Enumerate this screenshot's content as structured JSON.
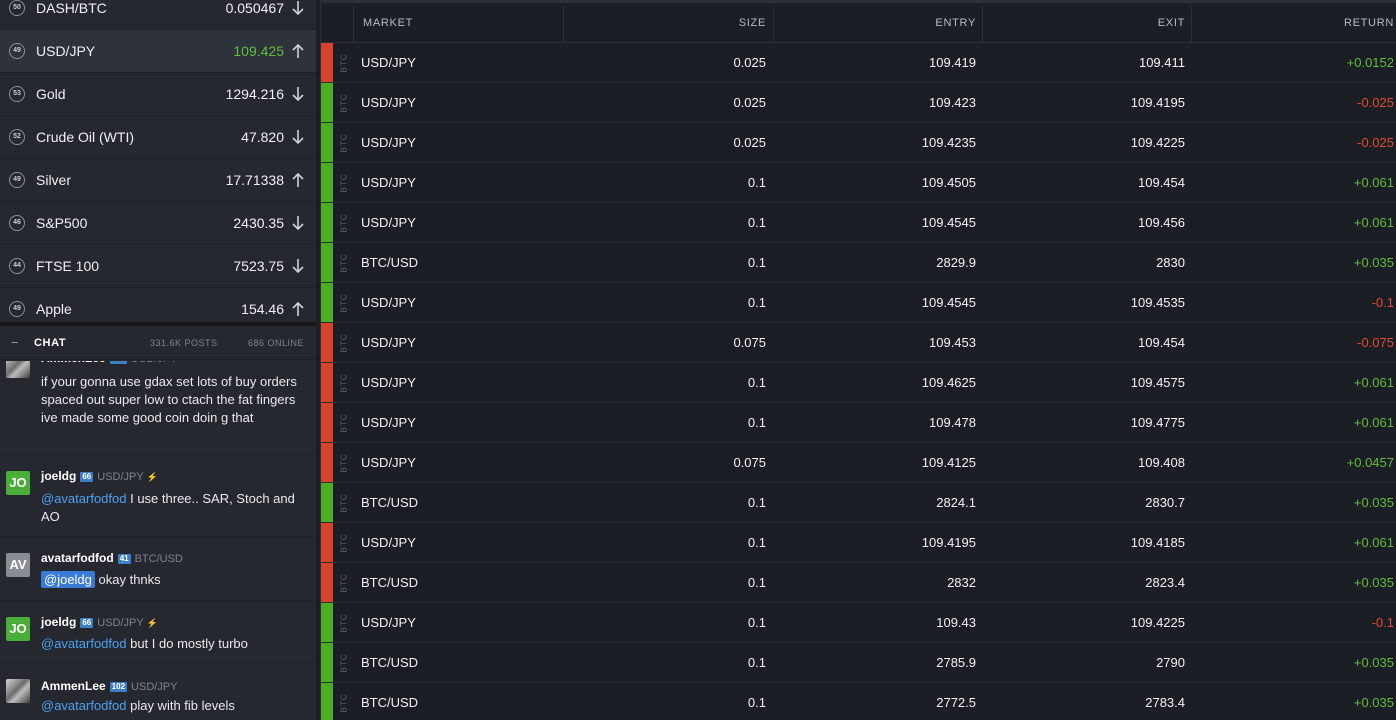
{
  "markets": [
    {
      "badge": "50",
      "name": "DASH/BTC",
      "price": "0.050467",
      "dir": "down",
      "selected": false
    },
    {
      "badge": "49",
      "name": "USD/JPY",
      "price": "109.425",
      "dir": "up",
      "selected": true
    },
    {
      "badge": "53",
      "name": "Gold",
      "price": "1294.216",
      "dir": "down",
      "selected": false
    },
    {
      "badge": "52",
      "name": "Crude Oil (WTI)",
      "price": "47.820",
      "dir": "down",
      "selected": false
    },
    {
      "badge": "49",
      "name": "Silver",
      "price": "17.71338",
      "dir": "up",
      "selected": false
    },
    {
      "badge": "46",
      "name": "S&P500",
      "price": "2430.35",
      "dir": "down",
      "selected": false
    },
    {
      "badge": "44",
      "name": "FTSE 100",
      "price": "7523.75",
      "dir": "down",
      "selected": false
    },
    {
      "badge": "49",
      "name": "Apple",
      "price": "154.46",
      "dir": "up",
      "selected": false
    }
  ],
  "chat": {
    "collapse": "−",
    "title": "CHAT",
    "posts": "331.6K POSTS",
    "online": "686 ONLINE",
    "messages": [
      {
        "avatar": "",
        "user": "",
        "level": "",
        "market": "",
        "bolt": "",
        "lines": [
          "if your gonna use gdax set lots of buy orders spaced out super low to ctach the fat fingers",
          "ive made some good coin doin g that"
        ]
      },
      {
        "avatar": "JO",
        "user": "joeldg",
        "level": "66",
        "market": "USD/JPY",
        "bolt": "⚡",
        "mention": "@avatarfodfod",
        "text": " I use three.. SAR, Stoch and AO"
      },
      {
        "avatar": "AV",
        "user": "avatarfodfod",
        "level": "41",
        "market": "BTC/USD",
        "bolt": "",
        "mention": "@joeldg",
        "text": " okay thnks"
      },
      {
        "avatar": "JO",
        "user": "joeldg",
        "level": "66",
        "market": "USD/JPY",
        "bolt": "⚡",
        "mention": "@avatarfodfod",
        "text": " but I do mostly turbo"
      },
      {
        "avatar": "",
        "user": "AmmenLee",
        "level": "102",
        "market": "USD/JPY",
        "bolt": "",
        "mention": "@avatarfodfod",
        "text": " play with fib levels"
      }
    ]
  },
  "table": {
    "headers": {
      "market": "MARKET",
      "size": "SIZE",
      "entry": "ENTRY",
      "exit": "EXIT",
      "return": "RETURN"
    },
    "asset_label": "BTC",
    "rows": [
      {
        "side": "red",
        "market": "USD/JPY",
        "size": "0.025",
        "entry": "109.419",
        "exit": "109.411",
        "ret": "+0.0152"
      },
      {
        "side": "green",
        "market": "USD/JPY",
        "size": "0.025",
        "entry": "109.423",
        "exit": "109.4195",
        "ret": "-0.025"
      },
      {
        "side": "green",
        "market": "USD/JPY",
        "size": "0.025",
        "entry": "109.4235",
        "exit": "109.4225",
        "ret": "-0.025"
      },
      {
        "side": "green",
        "market": "USD/JPY",
        "size": "0.1",
        "entry": "109.4505",
        "exit": "109.454",
        "ret": "+0.061"
      },
      {
        "side": "green",
        "market": "USD/JPY",
        "size": "0.1",
        "entry": "109.4545",
        "exit": "109.456",
        "ret": "+0.061"
      },
      {
        "side": "green",
        "market": "BTC/USD",
        "size": "0.1",
        "entry": "2829.9",
        "exit": "2830",
        "ret": "+0.035"
      },
      {
        "side": "green",
        "market": "USD/JPY",
        "size": "0.1",
        "entry": "109.4545",
        "exit": "109.4535",
        "ret": "-0.1"
      },
      {
        "side": "red",
        "market": "USD/JPY",
        "size": "0.075",
        "entry": "109.453",
        "exit": "109.454",
        "ret": "-0.075"
      },
      {
        "side": "red",
        "market": "USD/JPY",
        "size": "0.1",
        "entry": "109.4625",
        "exit": "109.4575",
        "ret": "+0.061"
      },
      {
        "side": "red",
        "market": "USD/JPY",
        "size": "0.1",
        "entry": "109.478",
        "exit": "109.4775",
        "ret": "+0.061"
      },
      {
        "side": "red",
        "market": "USD/JPY",
        "size": "0.075",
        "entry": "109.4125",
        "exit": "109.408",
        "ret": "+0.0457"
      },
      {
        "side": "green",
        "market": "BTC/USD",
        "size": "0.1",
        "entry": "2824.1",
        "exit": "2830.7",
        "ret": "+0.035"
      },
      {
        "side": "red",
        "market": "USD/JPY",
        "size": "0.1",
        "entry": "109.4195",
        "exit": "109.4185",
        "ret": "+0.061"
      },
      {
        "side": "red",
        "market": "BTC/USD",
        "size": "0.1",
        "entry": "2832",
        "exit": "2823.4",
        "ret": "+0.035"
      },
      {
        "side": "green",
        "market": "USD/JPY",
        "size": "0.1",
        "entry": "109.43",
        "exit": "109.4225",
        "ret": "-0.1"
      },
      {
        "side": "green",
        "market": "BTC/USD",
        "size": "0.1",
        "entry": "2785.9",
        "exit": "2790",
        "ret": "+0.035"
      },
      {
        "side": "green",
        "market": "BTC/USD",
        "size": "0.1",
        "entry": "2772.5",
        "exit": "2783.4",
        "ret": "+0.035"
      }
    ]
  },
  "colors": {
    "up": "#5fbf3a",
    "down": "#e24a2e",
    "side_red": "#d9412a",
    "side_green": "#4cae22",
    "mention": "#4ea1f0"
  }
}
